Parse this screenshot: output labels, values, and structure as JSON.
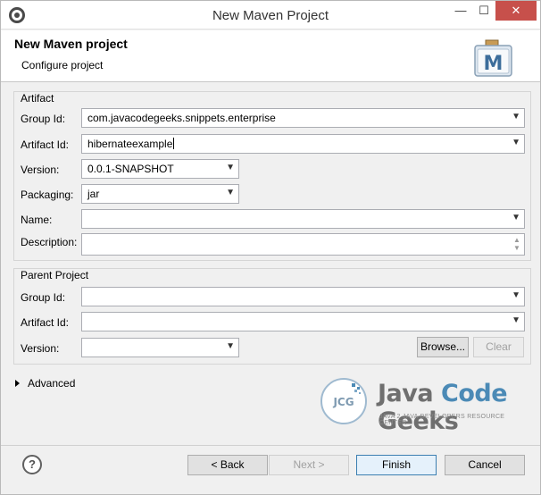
{
  "window": {
    "title": "New Maven Project"
  },
  "header": {
    "title": "New Maven project",
    "subtitle": "Configure project",
    "logo_letter": "M"
  },
  "artifact": {
    "group_label": "Artifact",
    "group_id_label": "Group Id:",
    "group_id_value": "com.javacodegeeks.snippets.enterprise",
    "artifact_id_label": "Artifact Id:",
    "artifact_id_value": "hibernateexample",
    "version_label": "Version:",
    "version_value": "0.0.1-SNAPSHOT",
    "packaging_label": "Packaging:",
    "packaging_value": "jar",
    "name_label": "Name:",
    "name_value": "",
    "description_label": "Description:",
    "description_value": ""
  },
  "parent": {
    "group_label": "Parent Project",
    "group_id_label": "Group Id:",
    "group_id_value": "",
    "artifact_id_label": "Artifact Id:",
    "artifact_id_value": "",
    "version_label": "Version:",
    "version_value": "",
    "browse_label": "Browse...",
    "clear_label": "Clear"
  },
  "advanced_label": "Advanced",
  "watermark": {
    "word1": "Java",
    "word2": "Code",
    "word3": "Geeks",
    "tagline": "JAVA 2 JAVA DEVELOPERS RESOURCE CENTER",
    "badge": "JCG"
  },
  "footer": {
    "help": "?",
    "back_label": "< Back",
    "next_label": "Next >",
    "finish_label": "Finish",
    "cancel_label": "Cancel"
  },
  "icons": {
    "dropdown": "chevron-down-icon",
    "help": "help-icon",
    "app": "eclipse-icon",
    "maven": "maven-logo-icon"
  }
}
